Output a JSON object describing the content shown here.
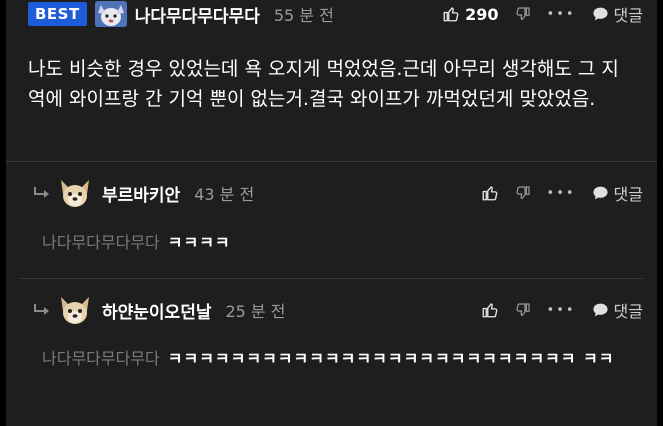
{
  "post": {
    "badge": "BEST",
    "username": "나다무다무다무다",
    "time": "55 분 전",
    "likes": "290",
    "reply_label": "댓글",
    "text": "나도 비슷한 경우 있었는데 욕 오지게 먹었었음.근데 아무리 생각해도 그 지역에 와이프랑 간 기억 뿐이 없는거.결국 와이프가 까먹었던게 맞았었음."
  },
  "replies": [
    {
      "username": "부르바키안",
      "time": "43 분 전",
      "reply_label": "댓글",
      "quote": "나다무다무다무다",
      "text": "ㅋㅋㅋㅋ"
    },
    {
      "username": "하얀눈이오던날",
      "time": "25 분 전",
      "reply_label": "댓글",
      "quote": "나다무다무다무다",
      "text": "ㅋㅋㅋㅋㅋㅋㅋㅋㅋㅋㅋㅋㅋㅋㅋㅋㅋㅋㅋㅋㅋㅋㅋㅋㅋㅋ ㅋㅋ"
    }
  ],
  "colors": {
    "badge_bg": "#1e5bd8",
    "background": "#1e1e1e",
    "muted_text": "#7a7a7a"
  }
}
